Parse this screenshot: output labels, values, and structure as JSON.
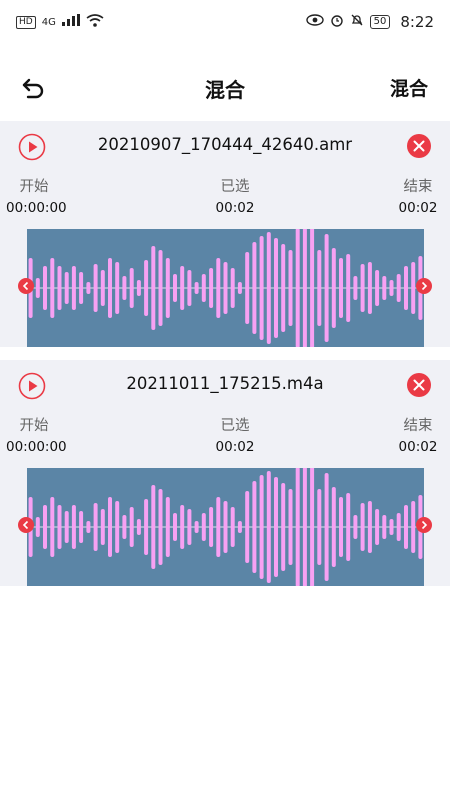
{
  "status_bar": {
    "network": "HD",
    "signal": "4G",
    "battery": "50",
    "time": "8:22"
  },
  "app_bar": {
    "title": "混合",
    "action_label": "混合"
  },
  "colors": {
    "waveform_bg": "#5b85a6",
    "waveform_bar": "#f7a1f3",
    "accent_red": "#ea3a45",
    "card_bg": "#f0f1f6"
  },
  "tracks": [
    {
      "filename": "20210907_170444_42640.amr",
      "start_label": "开始",
      "start_value": "00:00:00",
      "selected_label": "已选",
      "selected_value": "00:02",
      "end_label": "结束",
      "end_value": "00:02"
    },
    {
      "filename": "20211011_175215.m4a",
      "start_label": "开始",
      "start_value": "00:00:00",
      "selected_label": "已选",
      "selected_value": "00:02",
      "end_label": "结束",
      "end_value": "00:02"
    }
  ]
}
